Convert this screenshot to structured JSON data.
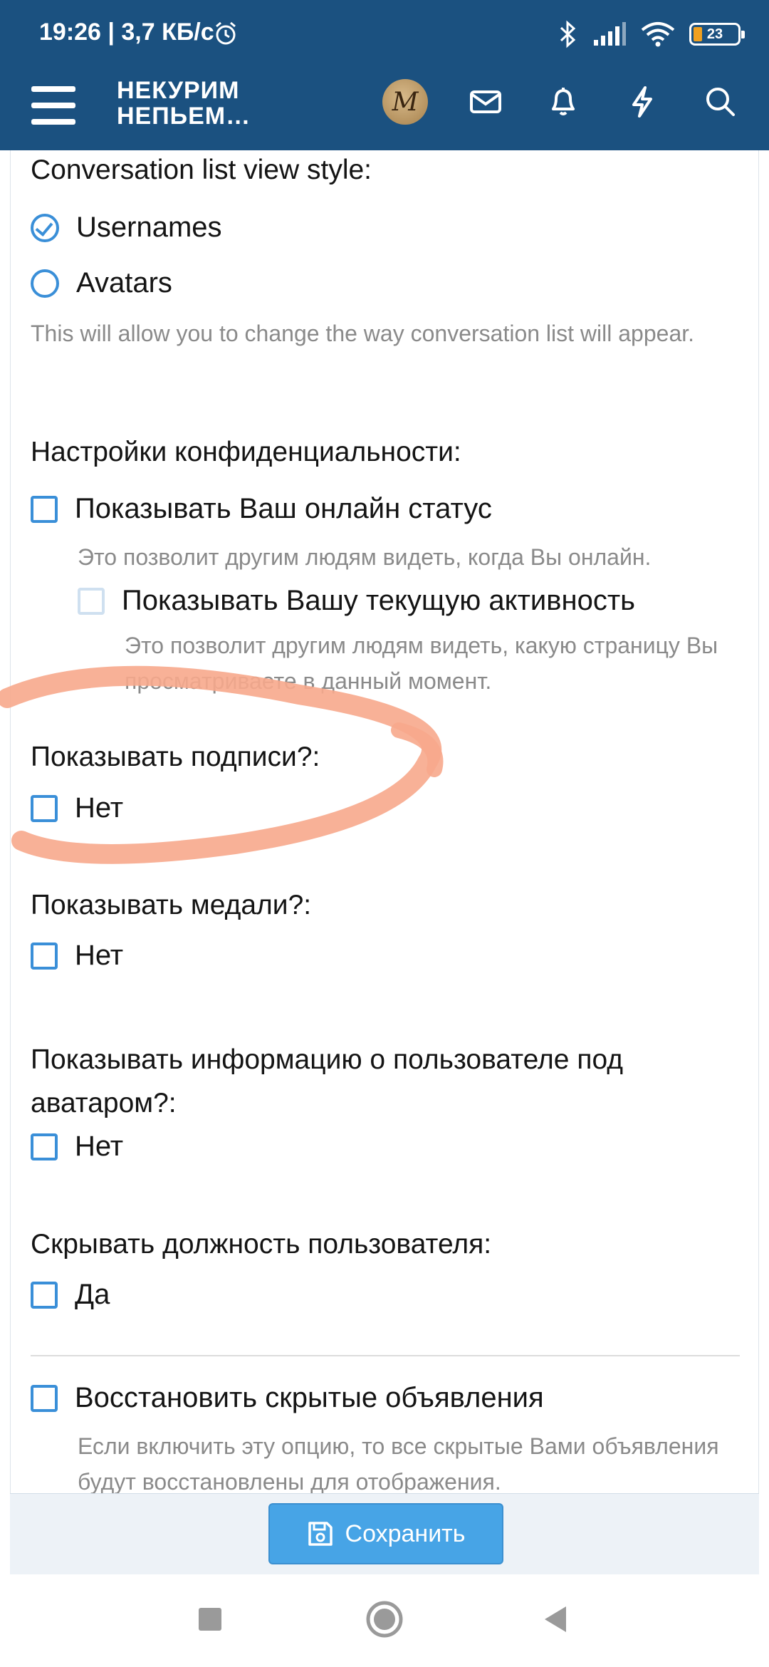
{
  "status_bar": {
    "time_speed": "19:26 | 3,7 КБ/с",
    "battery": "23"
  },
  "header": {
    "brand_line1": "НЕКУРИМ",
    "brand_line2": "НЕПЬЕМ…",
    "avatar_letter": "M"
  },
  "settings": {
    "conversation_style_label": "Conversation list view style:",
    "opt_usernames": "Usernames",
    "opt_avatars": "Avatars",
    "conversation_hint": "This will allow you to change the way conversation list will appear.",
    "privacy_label": "Настройки конфиденциальности:",
    "show_online": "Показывать Ваш онлайн статус",
    "show_online_hint": "Это позволит другим людям видеть, когда Вы онлайн.",
    "show_activity": "Показывать Вашу текущую активность",
    "show_activity_hint": "Это позволит другим людям видеть, какую страницу Вы просматриваете в данный момент.",
    "signatures_label": "Показывать подписи?:",
    "signatures_opt": "Нет",
    "medals_label": "Показывать медали?:",
    "medals_opt": "Нет",
    "userinfo_label": "Показывать информацию о пользователе под аватаром?:",
    "userinfo_opt": "Нет",
    "hide_title_label": "Скрывать должность пользователя:",
    "hide_title_opt": "Да",
    "restore_notices": "Восстановить скрытые объявления",
    "restore_notices_hint": "Если включить эту опцию, то все скрытые Вами объявления будут восстановлены для отображения."
  },
  "save_button": "Сохранить",
  "colors": {
    "header": "#1b5180",
    "accent": "#3a8fd8",
    "save": "#47a4e6",
    "highlight": "#f7a98c"
  }
}
